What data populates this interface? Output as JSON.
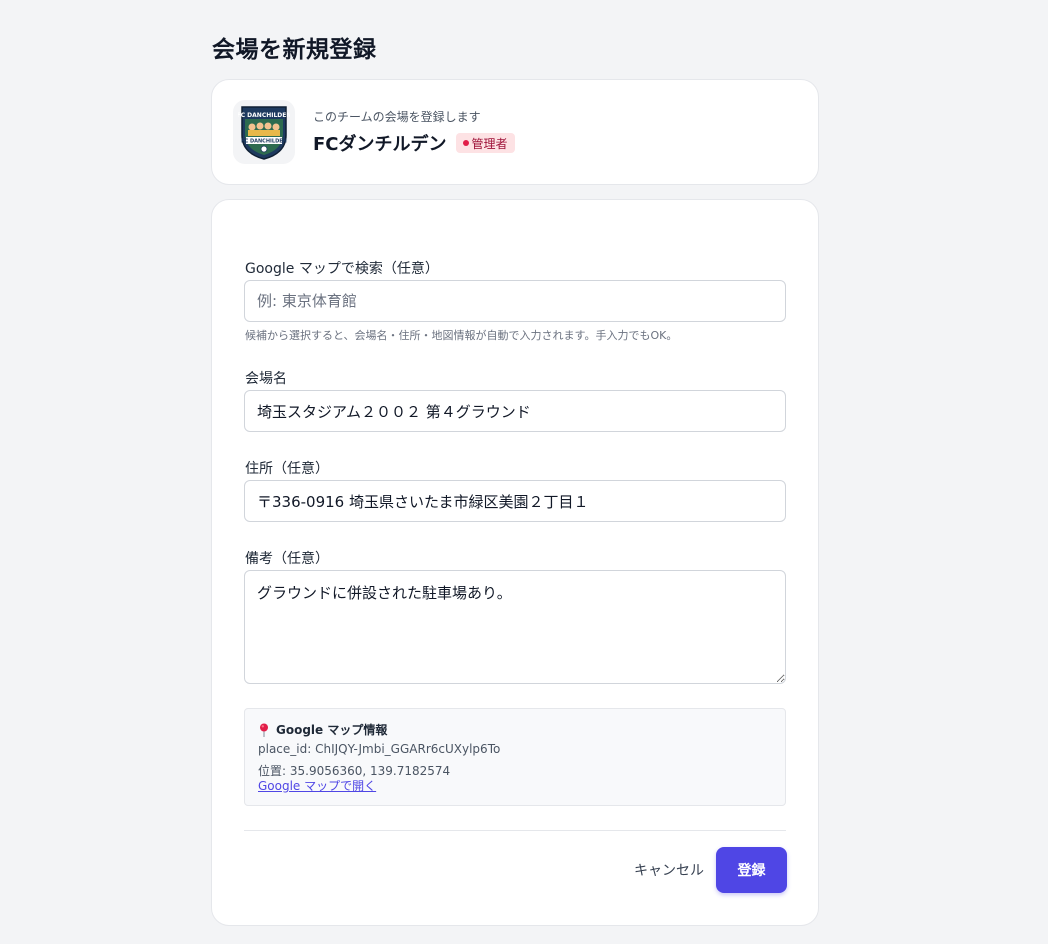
{
  "page": {
    "title": "会場を新規登録"
  },
  "team": {
    "subtitle": "このチームの会場を登録します",
    "name": "FCダンチルデン",
    "role_badge": "管理者",
    "logo_icon": "team-crest"
  },
  "form": {
    "search": {
      "label": "Google マップで検索（任意）",
      "placeholder": "例: 東京体育館",
      "value": "",
      "help": "候補から選択すると、会場名・住所・地図情報が自動で入力されます。手入力でもOK。"
    },
    "venue_name": {
      "label": "会場名",
      "value": "埼玉スタジアム２００２ 第４グラウンド"
    },
    "address": {
      "label": "住所（任意）",
      "value": "〒336-0916 埼玉県さいたま市緑区美園２丁目１"
    },
    "notes": {
      "label": "備考（任意）",
      "value": "グラウンドに併設された駐車場あり。"
    },
    "map_info": {
      "title": "Google マップ情報",
      "icon": "pin-icon",
      "place_id": "place_id: ChIJQY-Jmbi_GGARr6cUXylp6To",
      "position": "位置: 35.9056360, 139.7182574",
      "link": "Google マップで開く"
    },
    "cancel_label": "キャンセル",
    "submit_label": "登録"
  },
  "colors": {
    "primary": "#4f46e5",
    "badge_bg": "#fde2e4",
    "badge_text": "#9f1239",
    "background": "#f3f4f6"
  }
}
